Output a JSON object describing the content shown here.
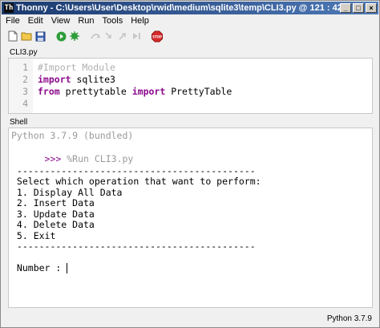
{
  "window": {
    "title": "Thonny  -  C:\\Users\\User\\Desktop\\rwid\\medium\\sqlite3\\temp\\CLI3.py  @  121 : 42",
    "app_icon_glyph": "Th"
  },
  "menu": [
    "File",
    "Edit",
    "View",
    "Run",
    "Tools",
    "Help"
  ],
  "toolbar": {
    "stop_label": "STOP"
  },
  "editor": {
    "tab_label": "CLI3.py",
    "lines": [
      {
        "num": "1",
        "parts": [
          {
            "t": "#Import Module",
            "c": "cmt"
          }
        ]
      },
      {
        "num": "2",
        "parts": [
          {
            "t": "import",
            "c": "kw"
          },
          {
            "t": " sqlite3",
            "c": "plain"
          }
        ]
      },
      {
        "num": "3",
        "parts": [
          {
            "t": "from",
            "c": "kw"
          },
          {
            "t": " prettytable ",
            "c": "plain"
          },
          {
            "t": "import",
            "c": "kw"
          },
          {
            "t": " PrettyTable",
            "c": "plain"
          }
        ]
      },
      {
        "num": "4",
        "parts": []
      }
    ]
  },
  "shell": {
    "tab_label": "Shell",
    "banner": "Python 3.7.9 (bundled)",
    "prompt": ">>>",
    "command": " %Run CLI3.py",
    "output": [
      "",
      " -------------------------------------------",
      " Select which operation that want to perform:",
      " 1. Display All Data",
      " 2. Insert Data",
      " 3. Update Data",
      " 4. Delete Data",
      " 5. Exit",
      " -------------------------------------------",
      "",
      " Number : "
    ]
  },
  "status": {
    "interpreter": "Python 3.7.9"
  },
  "colors": {
    "keyword": "#8c0a8c",
    "comment": "#b0b0b0",
    "prompt": "#9c3aa0",
    "titlebar_start": "#1b3a6e",
    "titlebar_end": "#4f7ab8"
  }
}
